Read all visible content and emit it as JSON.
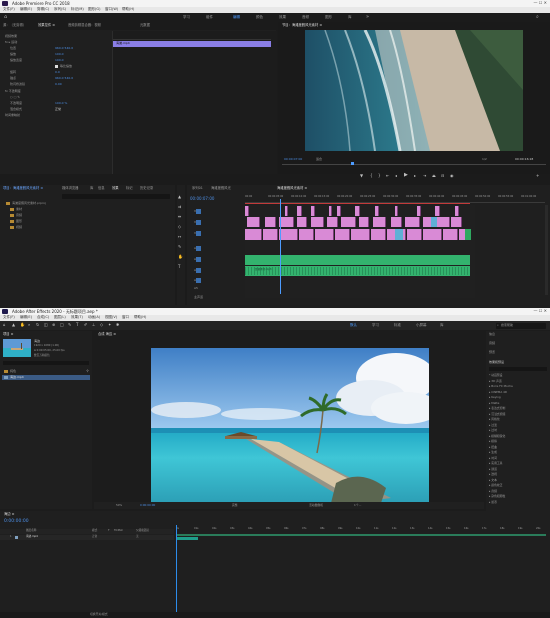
{
  "premiere": {
    "window_title": "Adobe Premiere Pro CC 2018",
    "menu": [
      "文件(F)",
      "编辑(E)",
      "剪辑(C)",
      "序列(S)",
      "标记(M)",
      "图形(G)",
      "窗口(W)",
      "帮助(H)"
    ],
    "workspaces": [
      "学习",
      "组件",
      "编辑",
      "颜色",
      "效果",
      "音频",
      "图形",
      "库"
    ],
    "active_workspace": "编辑",
    "source_tabs": [
      "源：（无剪辑）",
      "效果控件 ≡",
      "音频剪辑混合器：视频",
      "元数据"
    ],
    "source_clip": "效果控件",
    "effect_rows": [
      "视频效果",
      "fx ▸ 运动",
      "位置",
      "缩放",
      "缩放宽度",
      "等比缩放",
      "旋转",
      "锚点",
      "防闪烁滤镜",
      "fx 不透明度",
      "○ □ ✎",
      "不透明度",
      "混合模式",
      "时间重映射"
    ],
    "effect_values": {
      "position": "960.0  540.0",
      "scale": "100.0",
      "scale_width": "100.0",
      "rotation": "0.0",
      "anchor": "960.0  540.0",
      "flicker": "0.00",
      "opacity": "100.0 %",
      "blend": "正常"
    },
    "effect_timecode": "00:00:00:00",
    "mini_timeline_clip": "海滩.mp4",
    "program_title": "节目：海滩度假风光素材 ≡",
    "program_timecode": "00:00:07:00",
    "program_fit": "适合",
    "program_ratio": "1/2",
    "program_duration": "00:00:16:18",
    "project_tabs": [
      "项目：海滩度假风光素材 ≡",
      "媒体浏览器",
      "库",
      "信息",
      "效果",
      "标记",
      "历史记录"
    ],
    "project_items": [
      "海滩度假风光素材.prproj",
      "素材",
      "音频",
      "图形",
      "视频"
    ],
    "timeline_tabs": [
      "序列01",
      "海滩度假风光",
      "海滩度假风光素材 ≡"
    ],
    "timeline_timecode": "00:00:07:00",
    "ruler_labels": [
      "00:00",
      "00:00:05:00",
      "00:00:10:00",
      "00:00:15:00",
      "00:00:20:00",
      "00:00:25:00",
      "00:00:30:00",
      "00:00:35:00",
      "00:00:40:00",
      "00:00:45:00",
      "00:00:50:00",
      "00:00:55:00",
      "00:01:00:00"
    ],
    "tracks": [
      "V3",
      "V2",
      "V1",
      "A1",
      "A2",
      "A3",
      "A4",
      "A5",
      "主声道"
    ],
    "audio_clip_label": "音频素材.mp3",
    "colors": {
      "video_clip": "#d98ad6",
      "audio_clip": "#33b36e",
      "selected_clip": "#8a7ee6",
      "accent": "#4d9cff"
    }
  },
  "aftereffects": {
    "window_title": "Adobe After Effects 2020 - 无标题项目.aep *",
    "menu": [
      "文件(F)",
      "编辑(E)",
      "合成(C)",
      "图层(L)",
      "效果(T)",
      "动画(A)",
      "视图(V)",
      "窗口",
      "帮助(H)"
    ],
    "workspaces": [
      "默认",
      "学习",
      "标准",
      "小屏幕",
      "库"
    ],
    "active_workspace": "默认",
    "search_placeholder": "搜索帮助",
    "project_tab": "项目 ≡",
    "comp_tab": "合成 海边 ≡",
    "thumb_info": [
      "海边",
      "1920 x 1080 (1.00)",
      "Δ 0:00:05:00, 25.00 fps",
      "数百万种颜色"
    ],
    "project_items": [
      "纯色",
      "海边.mp4"
    ],
    "comp_footer": {
      "zoom": "50%",
      "time": "0:00:00:00",
      "res": "完整",
      "camera": "活动摄像机",
      "views": "1个…"
    },
    "right_panels": [
      "信息",
      "音频",
      "预览",
      "效果和预设",
      "对齐",
      "库",
      "字符",
      "段落",
      "跟踪器"
    ],
    "effects_list": [
      "* 动画预设",
      "▸ 3D 声道",
      "▸ Boris FX Mocha",
      "▸ CINEMA 4D",
      "▸ Keying",
      "▸ Matte",
      "▸ 表达式控制",
      "▸ 沉浸式视频",
      "▸ 风格化",
      "▸ 过渡",
      "▸ 过时",
      "▸ 模糊和锐化",
      "▸ 模拟",
      "▸ 扭曲",
      "▸ 生成",
      "▸ 时间",
      "▸ 实用工具",
      "▸ 通道",
      "▸ 透视",
      "▸ 文本",
      "▸ 颜色校正",
      "▸ 音频",
      "▸ 杂色和颗粒",
      "▸ 遮罩"
    ],
    "timeline_tab": "海边 ≡",
    "timecode": "0:00:00:00",
    "layer_headers": [
      "图层名称",
      "模式",
      "T",
      "TrkMat",
      "父级和链接"
    ],
    "layer": {
      "number": "1",
      "name": "海边.mp4",
      "mode": "正常",
      "parent": "无"
    },
    "ruler_labels": [
      "0s",
      "01s",
      "02s",
      "03s",
      "04s",
      "05s",
      "06s",
      "07s",
      "08s",
      "09s",
      "10s",
      "11s",
      "12s",
      "13s",
      "14s",
      "15s",
      "16s",
      "17s",
      "18s",
      "19s",
      "20s"
    ],
    "footer": "切换开关/模式",
    "colors": {
      "accent": "#2d8ceb",
      "layer_bar": "#1f9e8a",
      "timeline_green": "#2a7c5a"
    }
  }
}
